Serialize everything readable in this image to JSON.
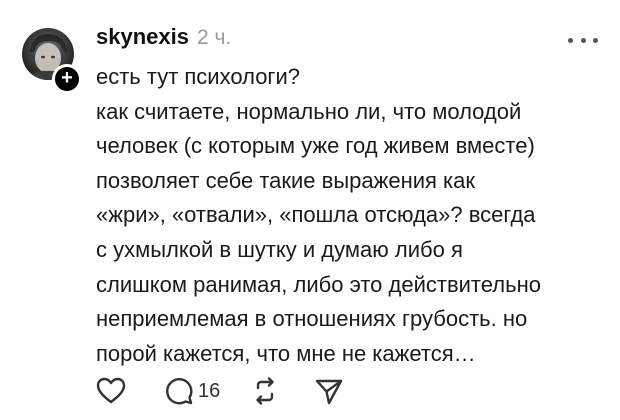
{
  "post": {
    "username": "skynexis",
    "timestamp": "2 ч.",
    "lines": [
      "есть тут психологи?",
      "как считаете, нормально ли, что молодой\nчеловек (с которым уже год живем вместе)\nпозволяет себе такие выражения как\n«жри», «отвали», «пошла отсюда»? всегда\nс ухмылкой в шутку и думаю либо я\nслишком ранимая, либо это действительно\nнеприемлемая в отношениях грубость. но\nпорой кажется, что мне не кажется…"
    ],
    "follow_symbol": "+",
    "actions": {
      "like_icon": "heart-icon",
      "reply_icon": "comment-icon",
      "reply_count": "16",
      "repost_icon": "repost-icon",
      "share_icon": "send-icon"
    }
  },
  "colors": {
    "text": "#1a1a1a",
    "muted": "#9a9a9a",
    "icon": "#333333",
    "badge": "#000000"
  }
}
